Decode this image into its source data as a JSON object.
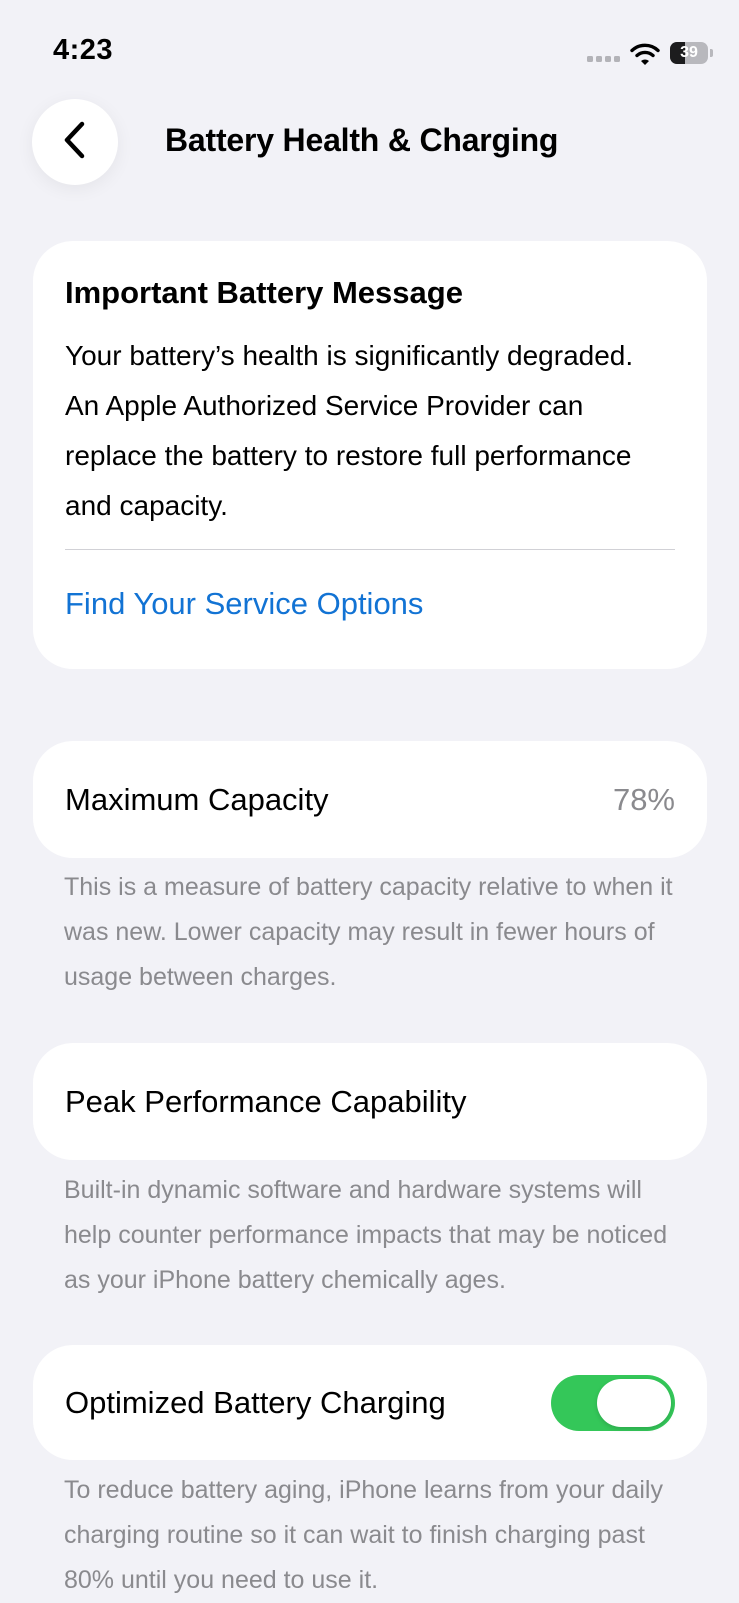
{
  "status_bar": {
    "time": "4:23",
    "battery_level": "39",
    "icons": [
      "signal-icon",
      "wifi-icon",
      "battery-icon"
    ]
  },
  "header": {
    "title": "Battery Health & Charging",
    "back_icon": "chevron-left-icon"
  },
  "message_card": {
    "title": "Important Battery Message",
    "body": "Your battery’s health is significantly degraded. An Apple Authorized Service Provider can replace the battery to restore full performance and capacity.",
    "link": "Find Your Service Options"
  },
  "maximum_capacity": {
    "label": "Maximum Capacity",
    "value": "78%",
    "note": "This is a measure of battery capacity relative to when it was new. Lower capacity may result in fewer hours of usage between charges."
  },
  "peak_performance": {
    "label": "Peak Performance Capability",
    "note": "Built-in dynamic software and hardware systems will help counter performance impacts that may be noticed as your iPhone battery chemically ages."
  },
  "optimized_charging": {
    "label": "Optimized Battery Charging",
    "enabled": true,
    "note": "To reduce battery aging, iPhone learns from your daily charging routine so it can wait to finish charging past 80% until you need to use it."
  },
  "colors": {
    "background": "#f2f2f7",
    "card": "#ffffff",
    "link": "#1273d4",
    "secondary_text": "#8a8a8e",
    "toggle_on": "#34c759"
  }
}
